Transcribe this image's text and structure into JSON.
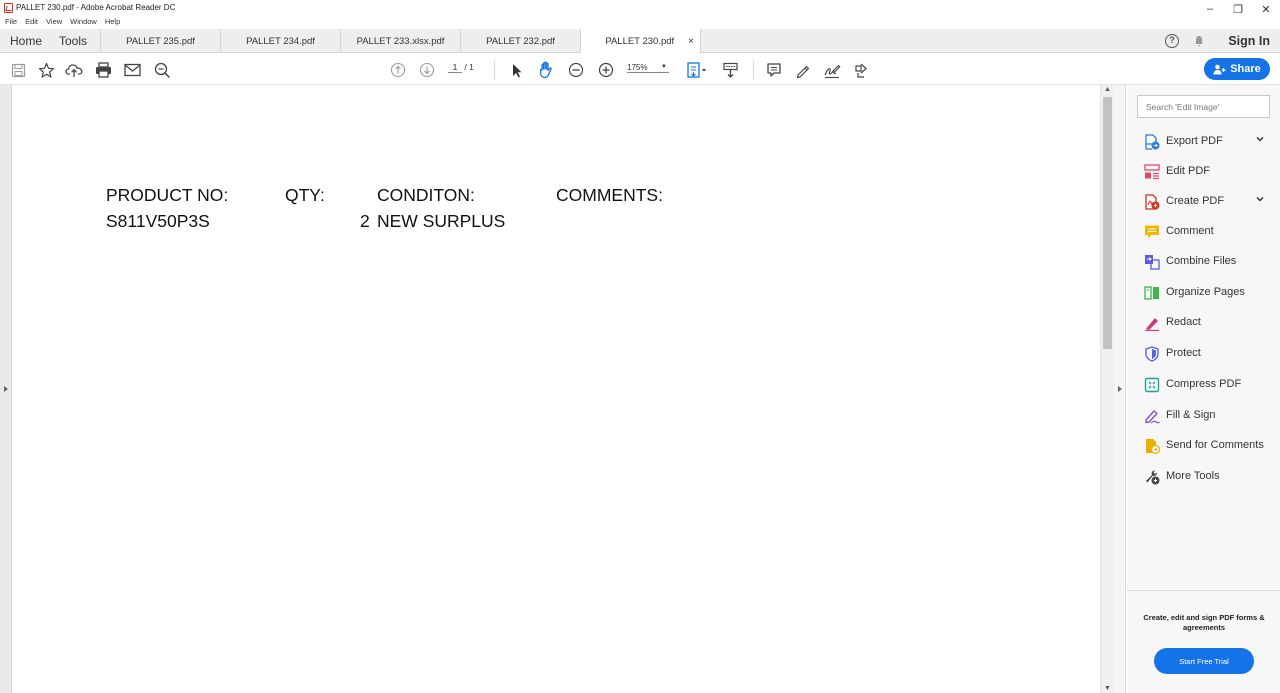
{
  "window": {
    "title": "PALLET 230.pdf - Adobe Acrobat Reader DC",
    "controls": [
      "–",
      "❐",
      "✕"
    ]
  },
  "menu": [
    "File",
    "Edit",
    "View",
    "Window",
    "Help"
  ],
  "tabs": {
    "home": "Home",
    "tools": "Tools",
    "documents": [
      "PALLET 235.pdf",
      "PALLET 234.pdf",
      "PALLET 233.xlsx.pdf",
      "PALLET 232.pdf",
      "PALLET 230.pdf"
    ],
    "active_index": 4,
    "close_glyph": "×",
    "sign_in": "Sign In",
    "help_glyph": "?"
  },
  "toolbar": {
    "page_current": "1",
    "page_total": "/ 1",
    "zoom": "175%",
    "share": "Share",
    "icons": [
      "save-icon",
      "bookmark-star-icon",
      "upload-cloud-icon",
      "print-icon",
      "email-icon",
      "find-zoom-icon",
      "page-up-icon",
      "page-down-icon",
      "select-arrow-icon",
      "hand-tool-icon",
      "zoom-out-icon",
      "zoom-in-icon",
      "fit-page-icon",
      "scroll-mode-icon",
      "comment-icon",
      "highlight-pen-icon",
      "sign-icon",
      "read-aloud-icon"
    ]
  },
  "document": {
    "headers": {
      "product": "PRODUCT NO:",
      "qty": "QTY:",
      "condition": "CONDITON:",
      "comments": "COMMENTS:"
    },
    "row": {
      "product": "S811V50P3S",
      "qty": "2",
      "condition": "NEW SURPLUS",
      "comments": ""
    }
  },
  "right_pane": {
    "search_placeholder": "Search 'Edit Image'",
    "tools": [
      {
        "label": "Export PDF",
        "icon": "export-pdf-icon",
        "color": "#2b7fd4",
        "expandable": true
      },
      {
        "label": "Edit PDF",
        "icon": "edit-pdf-icon",
        "color": "#e04a6b",
        "expandable": false
      },
      {
        "label": "Create PDF",
        "icon": "create-pdf-icon",
        "color": "#d6301f",
        "expandable": true
      },
      {
        "label": "Comment",
        "icon": "comment-icon",
        "color": "#f2b705",
        "expandable": false
      },
      {
        "label": "Combine Files",
        "icon": "combine-files-icon",
        "color": "#5c5ce0",
        "expandable": false
      },
      {
        "label": "Organize Pages",
        "icon": "organize-pages-icon",
        "color": "#3fb54a",
        "expandable": false
      },
      {
        "label": "Redact",
        "icon": "redact-icon",
        "color": "#d9327a",
        "expandable": false
      },
      {
        "label": "Protect",
        "icon": "protect-icon",
        "color": "#5568e0",
        "expandable": false
      },
      {
        "label": "Compress PDF",
        "icon": "compress-pdf-icon",
        "color": "#1aa59b",
        "expandable": false
      },
      {
        "label": "Fill & Sign",
        "icon": "fill-sign-icon",
        "color": "#8a4fd6",
        "expandable": false
      },
      {
        "label": "Send for Comments",
        "icon": "send-for-comments-icon",
        "color": "#e8b000",
        "expandable": false
      },
      {
        "label": "More Tools",
        "icon": "more-tools-icon",
        "color": "#444444",
        "expandable": false
      }
    ],
    "promo_text": "Create, edit and sign PDF forms & agreements",
    "promo_button": "Start Free Trial"
  },
  "colors": {
    "accent": "#1473e6",
    "acrobat_red": "#d6301f"
  }
}
